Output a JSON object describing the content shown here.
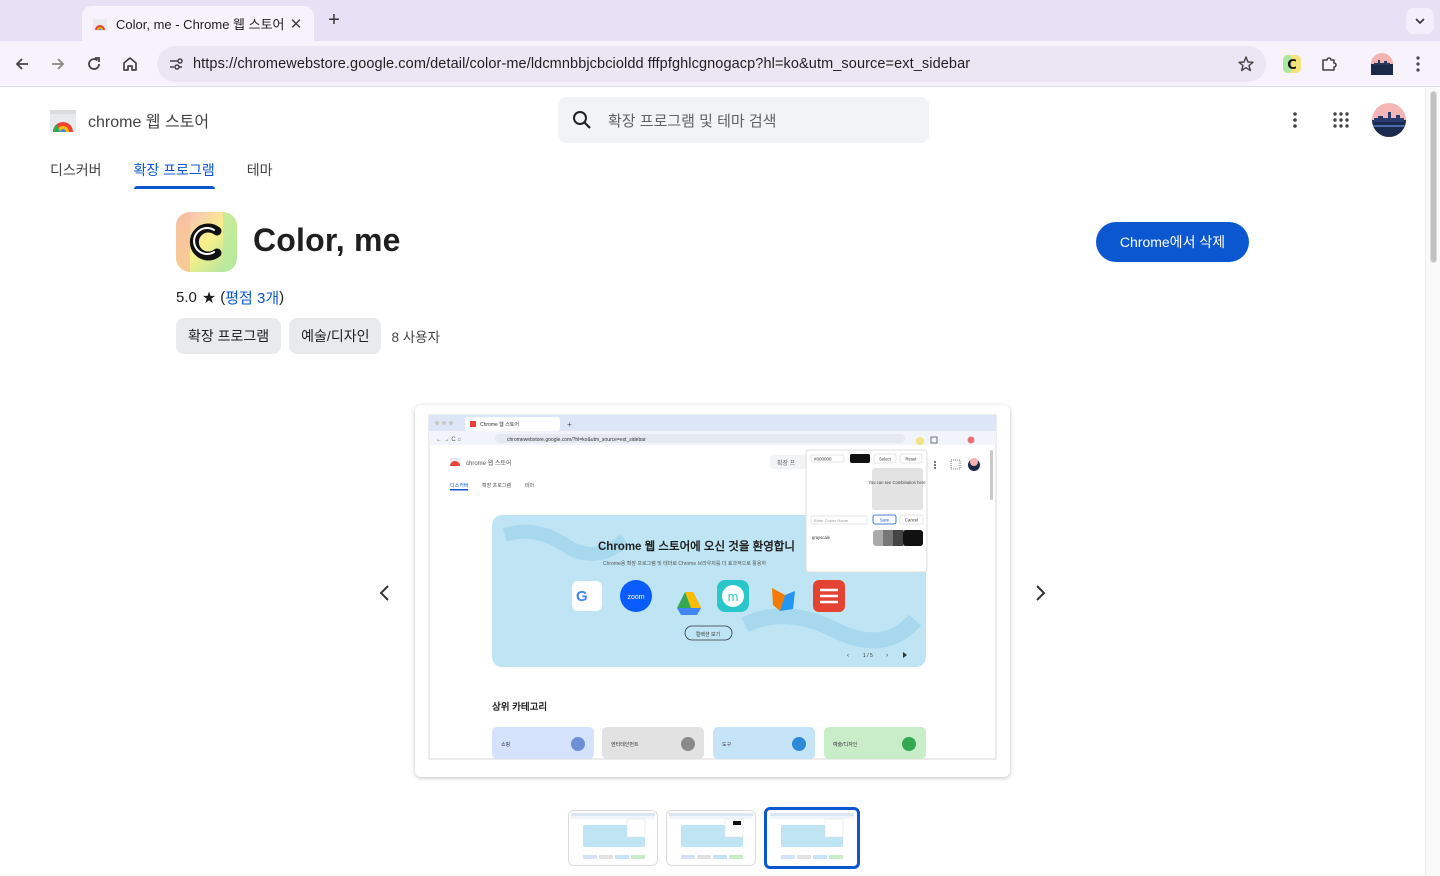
{
  "browser": {
    "tab_title": "Color, me - Chrome 웹 스토어",
    "url": "https://chromewebstore.google.com/detail/color-me/ldcmnbbjcbcioldd fffpfghlcgnogacp?hl=ko&utm_source=ext_sidebar"
  },
  "store": {
    "logo_text": "chrome 웹 스토어",
    "search_placeholder": "확장 프로그램 및 테마 검색",
    "nav": [
      "디스커버",
      "확장 프로그램",
      "테마"
    ]
  },
  "item": {
    "title": "Color, me",
    "rating_value": "5.0",
    "rating_star": "★",
    "rating_open": "(",
    "rating_link": "평점 3개",
    "rating_close": ")",
    "chip_type": "확장 프로그램",
    "chip_category": "예술/디자인",
    "users": "8 사용자",
    "remove_button": "Chrome에서 삭제"
  },
  "screenshot": {
    "tab": "Chrome 웹 스토어",
    "url": "chromewebstore.google.com/?hl=ko&utm_source=ext_sidebar",
    "logo": "chrome 웹 스토어",
    "search": "확장 프",
    "nav": [
      "디스커버",
      "확장 프로그램",
      "테마"
    ],
    "hero_title": "Chrome 웹 스토어에 오신 것을 환영합니",
    "hero_sub": "Chrome용 확장 프로그램 및 테마로 Chrome 브라우저를 더 효과적으로 활용하",
    "hero_button": "컬렉션 보기",
    "pager": "1 / 5",
    "zoom": "zoom",
    "m": "m",
    "section": "상위 카테고리",
    "cats": [
      "쇼핑",
      "엔터테인먼트",
      "도구",
      "예술/디자인"
    ],
    "popup": {
      "hex": "#000000",
      "select": "Select",
      "reset": "Reset",
      "preview": "You can see Combination here",
      "name_ph": "Enter Colors Name",
      "save": "Save",
      "cancel": "Cancel",
      "saved": "grayscale"
    }
  },
  "colors": {
    "accent": "#0b57d0",
    "tabstrip": "#e8e1f5",
    "toolbar": "#f7f2fc"
  }
}
